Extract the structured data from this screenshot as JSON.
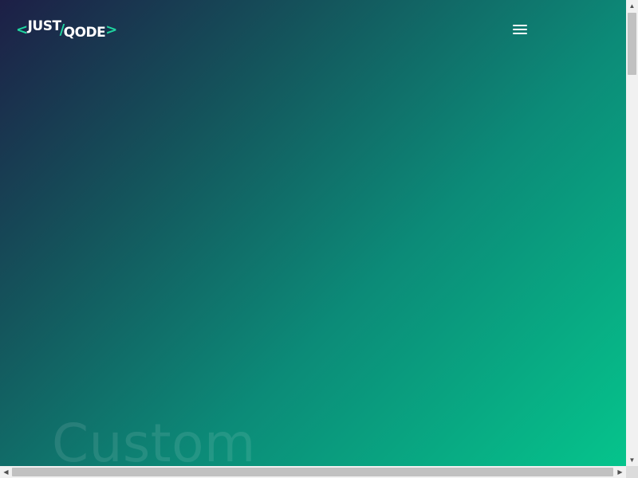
{
  "header": {
    "logo": {
      "bracket_open": "<",
      "word1": "JUST",
      "slash": "/",
      "word2": "QODE",
      "bracket_close": ">",
      "accent_color": "#1fd6a0"
    },
    "menu_icon": "hamburger-menu-icon"
  },
  "hero": {
    "title_partial": "Custom"
  },
  "colors": {
    "gradient_start": "#1d1f46",
    "gradient_mid": "#0c8b78",
    "gradient_end": "#05c48c"
  },
  "scrollbars": {
    "vertical": {
      "up_glyph": "▲",
      "down_glyph": "▼"
    },
    "horizontal": {
      "left_glyph": "◀",
      "right_glyph": "▶"
    }
  }
}
